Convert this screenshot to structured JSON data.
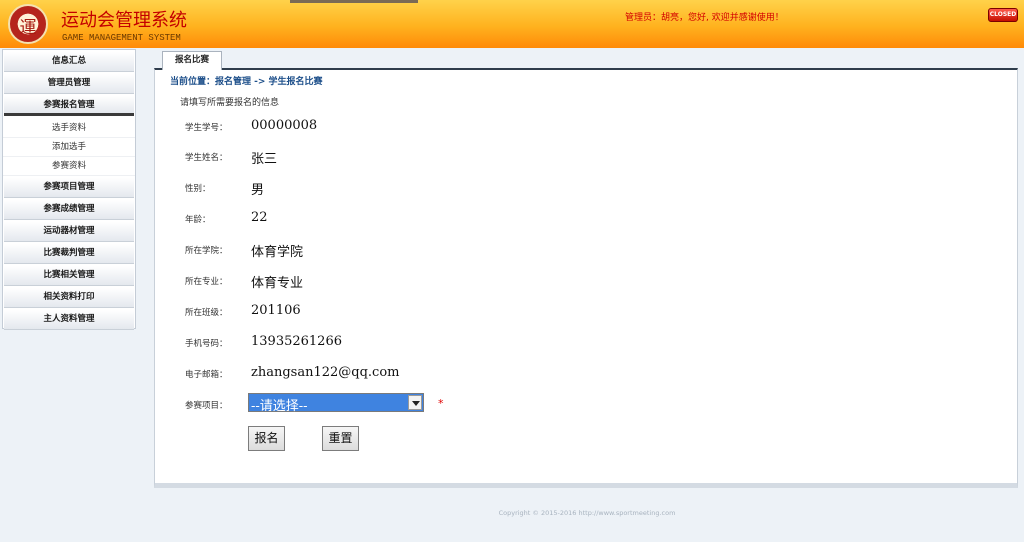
{
  "header": {
    "title": "运动会管理系统",
    "subtitle": "GAME MANAGEMENT SYSTEM",
    "welcome": "管理员：胡亮，您好, 欢迎并感谢使用！",
    "close_label": "CLOSED"
  },
  "sidebar": {
    "items": [
      {
        "label": "信息汇总"
      },
      {
        "label": "管理员管理"
      },
      {
        "label": "参赛报名管理"
      },
      {
        "label": "参赛项目管理"
      },
      {
        "label": "参赛成绩管理"
      },
      {
        "label": "运动器材管理"
      },
      {
        "label": "比赛裁判管理"
      },
      {
        "label": "比赛相关管理"
      },
      {
        "label": "相关资料打印"
      },
      {
        "label": "主人资料管理"
      }
    ],
    "sub_items": [
      {
        "label": "选手资料"
      },
      {
        "label": "添加选手"
      },
      {
        "label": "参赛资料"
      }
    ]
  },
  "main": {
    "tab": "报名比赛",
    "breadcrumb": "当前位置：报名管理 -> 学生报名比赛",
    "hint": "请填写所需要报名的信息",
    "fields": [
      {
        "label": "学生学号：",
        "value": "00000008"
      },
      {
        "label": "学生姓名：",
        "value": "张三"
      },
      {
        "label": "性别：",
        "value": "男"
      },
      {
        "label": "年龄：",
        "value": "22"
      },
      {
        "label": "所在学院：",
        "value": "体育学院"
      },
      {
        "label": "所在专业：",
        "value": "体育专业"
      },
      {
        "label": "所在班级：",
        "value": "201106"
      },
      {
        "label": "手机号码：",
        "value": "13935261266"
      },
      {
        "label": "电子邮箱：",
        "value": "zhangsan122@qq.com"
      }
    ],
    "project_label": "参赛项目：",
    "project_select": "--请选择--",
    "required_mark": "*",
    "submit_label": "报名",
    "reset_label": "重置"
  },
  "footer": {
    "copyright": "Copyright © 2015-2016 http://www.sportmeeting.com"
  }
}
